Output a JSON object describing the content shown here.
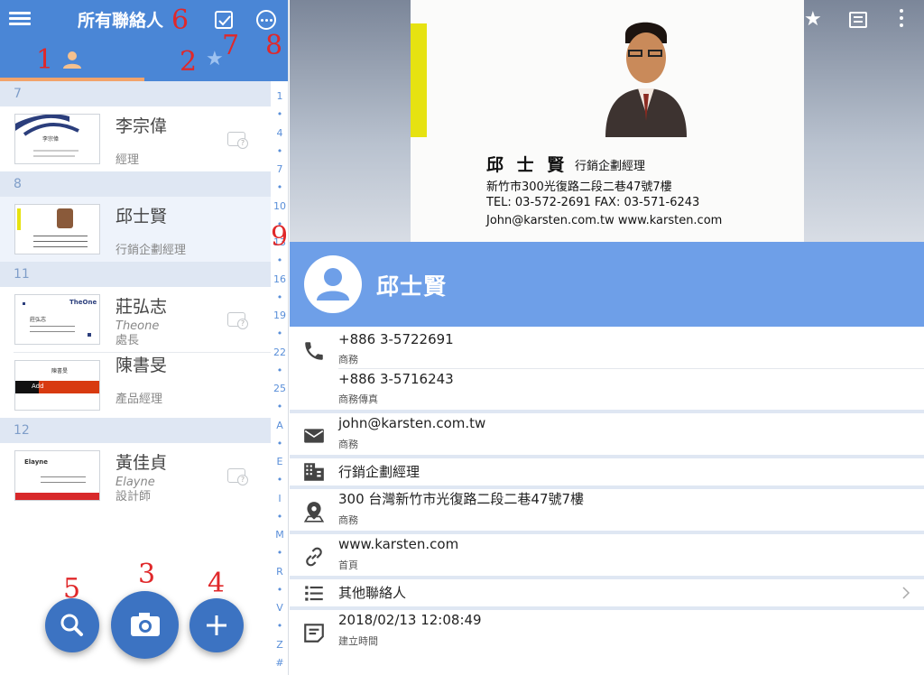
{
  "header": {
    "title": "所有聯絡人"
  },
  "annotations": [
    "1",
    "2",
    "3",
    "4",
    "5",
    "6",
    "7",
    "8",
    "9"
  ],
  "sections": [
    {
      "letter": "7",
      "contacts": [
        {
          "name": "李宗偉",
          "lines": [
            "經理"
          ]
        }
      ]
    },
    {
      "letter": "8",
      "contacts": [
        {
          "name": "邱士賢",
          "lines": [
            "行銷企劃經理"
          ]
        }
      ]
    },
    {
      "letter": "11",
      "contacts": [
        {
          "name": "莊弘志",
          "lines": [
            "Theone",
            "處長"
          ]
        },
        {
          "name": "陳書旻",
          "lines": [
            "產品經理"
          ]
        }
      ]
    },
    {
      "letter": "12",
      "contacts": [
        {
          "name": "黃佳貞",
          "lines": [
            "Elayne",
            "設計師"
          ]
        }
      ]
    }
  ],
  "card_texts": {
    "c1": "李宗偉",
    "c3a": "TheOne",
    "c3b": "莊弘志",
    "c4": "陳書旻",
    "c4b": "Add",
    "c5": "Elayne"
  },
  "index_labels": [
    "1",
    "•",
    "4",
    "•",
    "7",
    "•",
    "10",
    "•",
    "13",
    "•",
    "16",
    "•",
    "19",
    "•",
    "22",
    "•",
    "25",
    "•",
    "A",
    "•",
    "E",
    "•",
    "I",
    "•",
    "M",
    "•",
    "R",
    "•",
    "V",
    "•",
    "Z",
    "#"
  ],
  "business_card": {
    "name": "邱 士 賢",
    "title": "行銷企劃經理",
    "address": "新竹市300光復路二段二巷47號7樓",
    "phones": "TEL: 03-572-2691    FAX: 03-571-6243",
    "web": "John@karsten.com.tw    www.karsten.com"
  },
  "detail": {
    "name": "邱士賢",
    "phone1": {
      "value": "+886 3-5722691",
      "label": "商務"
    },
    "phone2": {
      "value": "+886 3-5716243",
      "label": "商務傳真"
    },
    "email": {
      "value": "john@karsten.com.tw",
      "label": "商務"
    },
    "job": {
      "value": "行銷企劃經理"
    },
    "address": {
      "value": "300 台灣新竹市光復路二段二巷47號7樓",
      "label": "商務"
    },
    "url": {
      "value": "www.karsten.com",
      "label": "首頁"
    },
    "other": {
      "value": "其他聯絡人"
    },
    "created": {
      "value": "2018/02/13 12:08:49",
      "label": "建立時間"
    }
  },
  "colors": {
    "appbar": "#4a86d6",
    "namebar": "#6e9fe8",
    "fab": "#3c73c2",
    "annotation": "#e0282a"
  }
}
